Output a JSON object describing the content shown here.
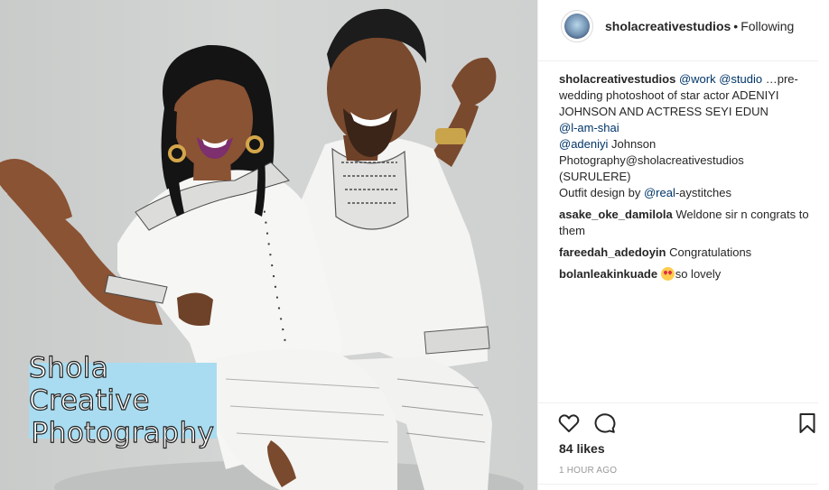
{
  "photo": {
    "watermark_line1": "Shola Creative",
    "watermark_line2": "Photography",
    "background_color": "#cfd1d0",
    "watermark_bg": "#a9dcf0"
  },
  "header": {
    "username": "sholacreativestudios",
    "separator": "•",
    "follow_state": "Following"
  },
  "caption": {
    "username": "sholacreativestudios",
    "mention_work": "@work",
    "mention_studio": "@studio",
    "text1": "…pre-wedding photoshoot of star actor ADENIYI JOHNSON AND ACTRESS SEYI EDUN",
    "mention_lamshai": "@l-am-shai",
    "mention_adeniyi": "@adeniyi",
    "text2": "Johnson Photography@sholacreativestudios (SURULERE)",
    "text3": "Outfit design by",
    "mention_real": "@real",
    "text4": "-aystitches"
  },
  "comments": [
    {
      "user": "asake_oke_damilola",
      "text": "Weldone sir n congrats to them"
    },
    {
      "user": "fareedah_adedoyin",
      "text": "Congratulations"
    },
    {
      "user": "bolanleakinkuade",
      "emoji": "heart-eyes-emoji",
      "text": "so lovely"
    }
  ],
  "actions": {
    "like_icon": "heart-outline-icon",
    "comment_icon": "comment-bubble-icon",
    "save_icon": "bookmark-icon"
  },
  "likes": "84 likes",
  "timestamp": "1 HOUR AGO",
  "colors": {
    "text": "#262626",
    "mention": "#003569",
    "muted": "#999999",
    "divider": "#efefef"
  }
}
